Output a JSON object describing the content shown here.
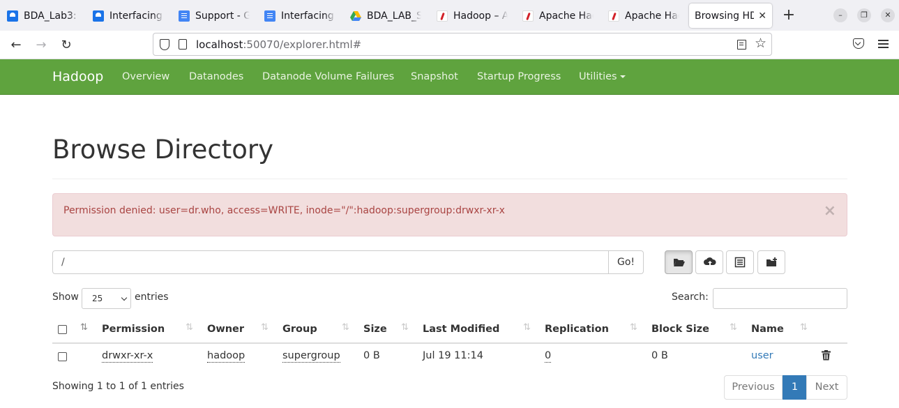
{
  "browser": {
    "tabs": [
      {
        "title": "BDA_Lab3: I",
        "favicon": "classroom-icon"
      },
      {
        "title": "Interfacing t",
        "favicon": "classroom-icon"
      },
      {
        "title": "Support - Go",
        "favicon": "docs-icon"
      },
      {
        "title": "Interfacing t",
        "favicon": "docs-icon"
      },
      {
        "title": "BDA_LAB_S",
        "favicon": "drive-icon"
      },
      {
        "title": "Hadoop – Ap",
        "favicon": "apache-icon"
      },
      {
        "title": "Apache Had",
        "favicon": "apache-icon"
      },
      {
        "title": "Apache Had",
        "favicon": "apache-icon"
      },
      {
        "title": "Browsing HD",
        "favicon": "none",
        "active": true
      }
    ],
    "new_tab_label": "+",
    "url_host": "localhost",
    "url_rest": ":50070/explorer.html#"
  },
  "hadoop_nav": {
    "brand": "Hadoop",
    "links": [
      "Overview",
      "Datanodes",
      "Datanode Volume Failures",
      "Snapshot",
      "Startup Progress",
      "Utilities"
    ]
  },
  "page": {
    "title": "Browse Directory",
    "alert": "Permission denied: user=dr.who, access=WRITE, inode=\"/\":hadoop:supergroup:drwxr-xr-x",
    "alert_close": "×",
    "directory_value": "/",
    "go_label": "Go!",
    "show_label": "Show",
    "entries_value": "25",
    "entries_label": "entries",
    "search_label": "Search:",
    "columns": [
      "Permission",
      "Owner",
      "Group",
      "Size",
      "Last Modified",
      "Replication",
      "Block Size",
      "Name"
    ],
    "rows": [
      {
        "permission": "drwxr-xr-x",
        "owner": "hadoop",
        "group": "supergroup",
        "size": "0 B",
        "last_modified": "Jul 19 11:14",
        "replication": "0",
        "block_size": "0 B",
        "name": "user"
      }
    ],
    "info": "Showing 1 to 1 of 1 entries",
    "pagination": {
      "previous": "Previous",
      "current": "1",
      "next": "Next"
    }
  },
  "colors": {
    "hadoop_green": "#5fa33e",
    "alert_bg": "#f2dede",
    "alert_text": "#a94442",
    "link": "#337ab7"
  }
}
